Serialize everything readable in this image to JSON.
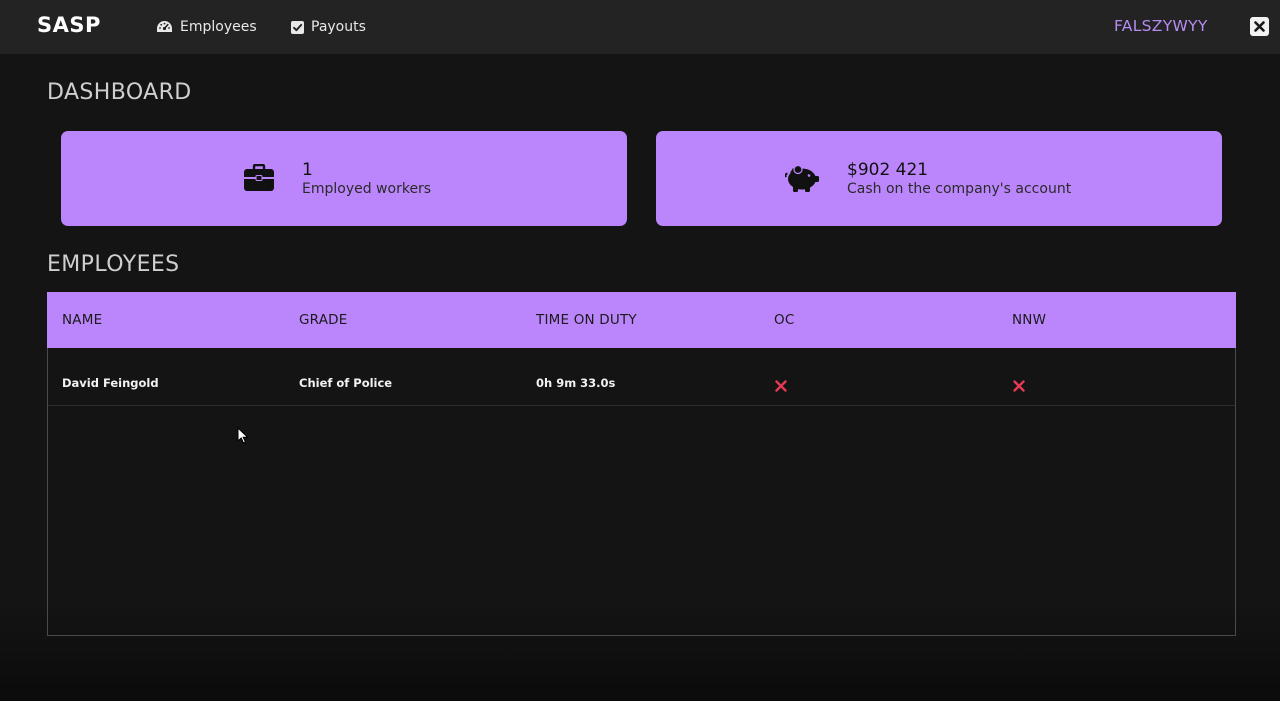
{
  "topbar": {
    "brand": "SASP",
    "nav": [
      {
        "label": "Employees",
        "icon": "gauge-icon"
      },
      {
        "label": "Payouts",
        "icon": "checkbox-icon"
      }
    ],
    "username": "FALSZYWYY",
    "close_icon": "close-icon"
  },
  "dashboard": {
    "title": "DASHBOARD",
    "cards": [
      {
        "value": "1",
        "label": "Employed workers",
        "icon": "briefcase-icon"
      },
      {
        "value": "$902 421",
        "label": "Cash on the company's account",
        "icon": "piggy-bank-icon"
      }
    ]
  },
  "employees": {
    "title": "EMPLOYEES",
    "columns": [
      "NAME",
      "GRADE",
      "TIME ON DUTY",
      "OC",
      "NNW"
    ],
    "rows": [
      {
        "name": "David Feingold",
        "grade": "Chief of Police",
        "time_on_duty": "0h 9m 33.0s",
        "oc": false,
        "nnw": false
      }
    ]
  },
  "colors": {
    "accent": "#bb86fc",
    "username": "#b48cf2",
    "negative": "#e53955",
    "background": "#141414",
    "topbar": "#232323"
  }
}
